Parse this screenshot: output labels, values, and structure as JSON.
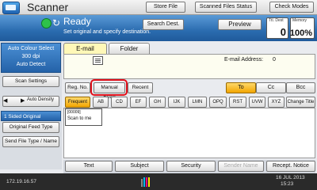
{
  "header": {
    "app_title": "Scanner",
    "store_file": "Store File",
    "scanned_files_status": "Scanned Files Status",
    "check_modes": "Check Modes"
  },
  "status": {
    "ready": "Ready",
    "instruction": "Set original and specify destination.",
    "search_dest": "Search Dest.",
    "preview": "Preview",
    "total_dest_label": "Ttl. Dest",
    "total_dest_value": "0",
    "memory_label": "Memory",
    "memory_value": "100%"
  },
  "left_panel": {
    "colour_line1": "Auto Colour Select",
    "colour_line2": "300 dpi",
    "colour_line3": "Auto Detect",
    "scan_settings": "Scan Settings",
    "auto_density": "Auto Density",
    "original_type": "1 Sided Original",
    "original_feed_type": "Original Feed Type",
    "send_file_type": "Send File Type / Name"
  },
  "tabs": {
    "email": "E-mail",
    "folder": "Folder"
  },
  "destination": {
    "email_address_label": "E-mail Address:",
    "email_address_count": "0"
  },
  "dest_buttons": {
    "reg_no": "Reg. No.",
    "manual_entry": "Manual Entry",
    "recent": "Recent",
    "to": "To",
    "cc": "Cc",
    "bcc": "Bcc"
  },
  "index_tabs": [
    "Frequent",
    "AB",
    "CD",
    "EF",
    "GH",
    "IJK",
    "LMN",
    "OPQ",
    "RST",
    "UVW",
    "XYZ",
    "Change Title"
  ],
  "entries": [
    {
      "number": "[00009]",
      "name": "Scan to me"
    }
  ],
  "bottom_buttons": {
    "text": "Text",
    "subject": "Subject",
    "security": "Security",
    "sender_name": "Sender Name",
    "recent_notice": "Recept. Notice"
  },
  "footer": {
    "ip": "172.19.16.57",
    "date": "16 JUL  2013",
    "time": "15:23"
  },
  "colors": {
    "status_blue": "#2b6cb0",
    "active_orange": "#f2a600",
    "highlight_red": "#e0101a",
    "email_tab": "#fff8b8"
  }
}
